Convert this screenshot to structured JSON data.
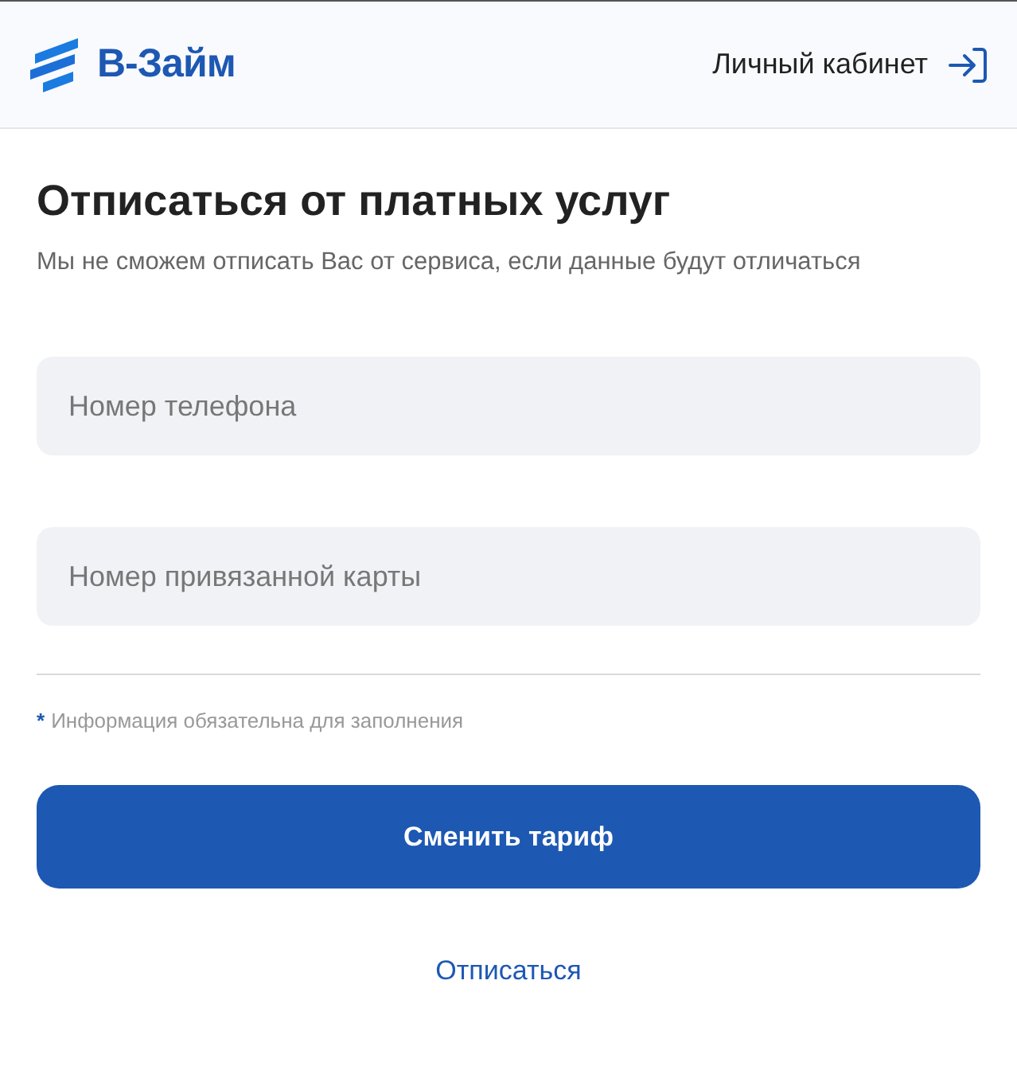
{
  "header": {
    "logo": "В-Займ",
    "account_link": "Личный кабинет"
  },
  "title": "Отписаться от платных услуг",
  "subtitle": "Мы не сможем отписать Вас от сервиса, если данные будут отличаться",
  "fields": [
    {
      "placeholder": "Номер телефона"
    },
    {
      "placeholder": "Номер привязанной карты"
    }
  ],
  "required_note": {
    "mark": "*",
    "text": "Информация обязательна для заполнения"
  },
  "primary_button": "Сменить тариф",
  "secondary_link": "Отписаться"
}
